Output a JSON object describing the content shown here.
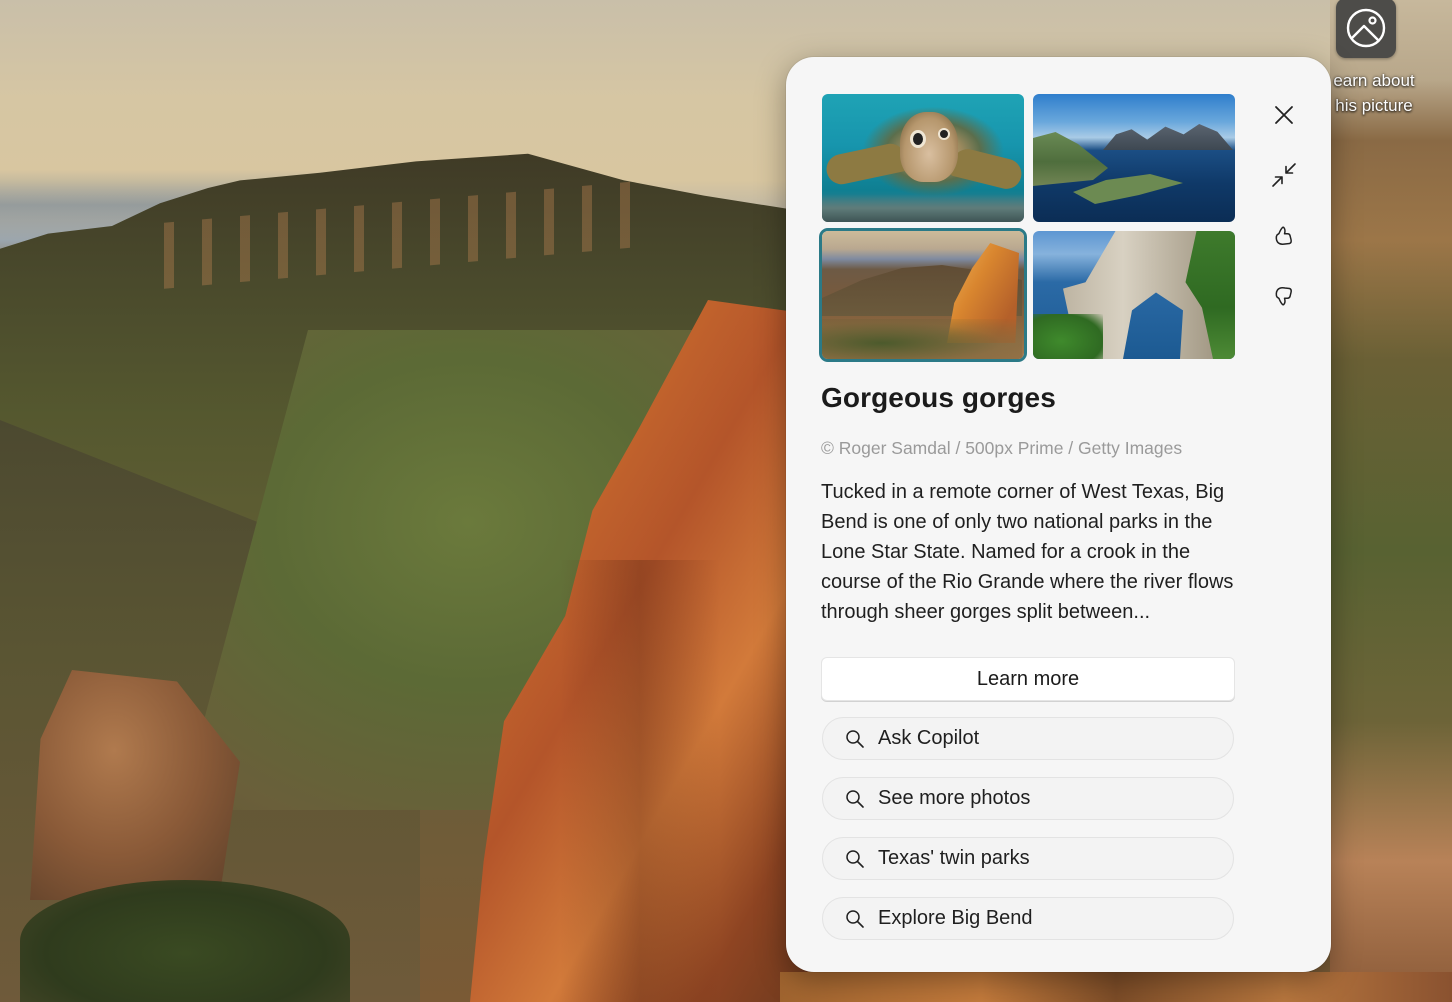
{
  "desktop": {
    "icon": "picture-info-icon",
    "icon_label": "earn about\nhis picture"
  },
  "panel": {
    "thumbnails": [
      {
        "name": "sea-turtle",
        "selected": false
      },
      {
        "name": "lofoten-islands",
        "selected": false
      },
      {
        "name": "big-bend-gorges",
        "selected": true
      },
      {
        "name": "rock-arch-coast",
        "selected": false
      }
    ],
    "side_buttons": [
      {
        "name": "close",
        "icon": "close-icon"
      },
      {
        "name": "collapse",
        "icon": "collapse-arrows-icon"
      },
      {
        "name": "like",
        "icon": "thumbs-up-icon"
      },
      {
        "name": "dislike",
        "icon": "thumbs-down-icon"
      }
    ],
    "title": "Gorgeous gorges",
    "credit": "© Roger Samdal / 500px Prime / Getty Images",
    "description": "Tucked in a remote corner of West Texas, Big Bend is one of only two national parks in the Lone Star State. Named for a crook in the course of the Rio Grande where the river flows through sheer gorges split between...",
    "learn_more_label": "Learn more",
    "suggestions": [
      {
        "label": "Ask Copilot",
        "icon": "search-icon"
      },
      {
        "label": "See more photos",
        "icon": "search-icon"
      },
      {
        "label": "Texas' twin parks",
        "icon": "search-icon"
      },
      {
        "label": "Explore Big Bend",
        "icon": "search-icon"
      }
    ],
    "accent_color": "#2b7a87"
  }
}
